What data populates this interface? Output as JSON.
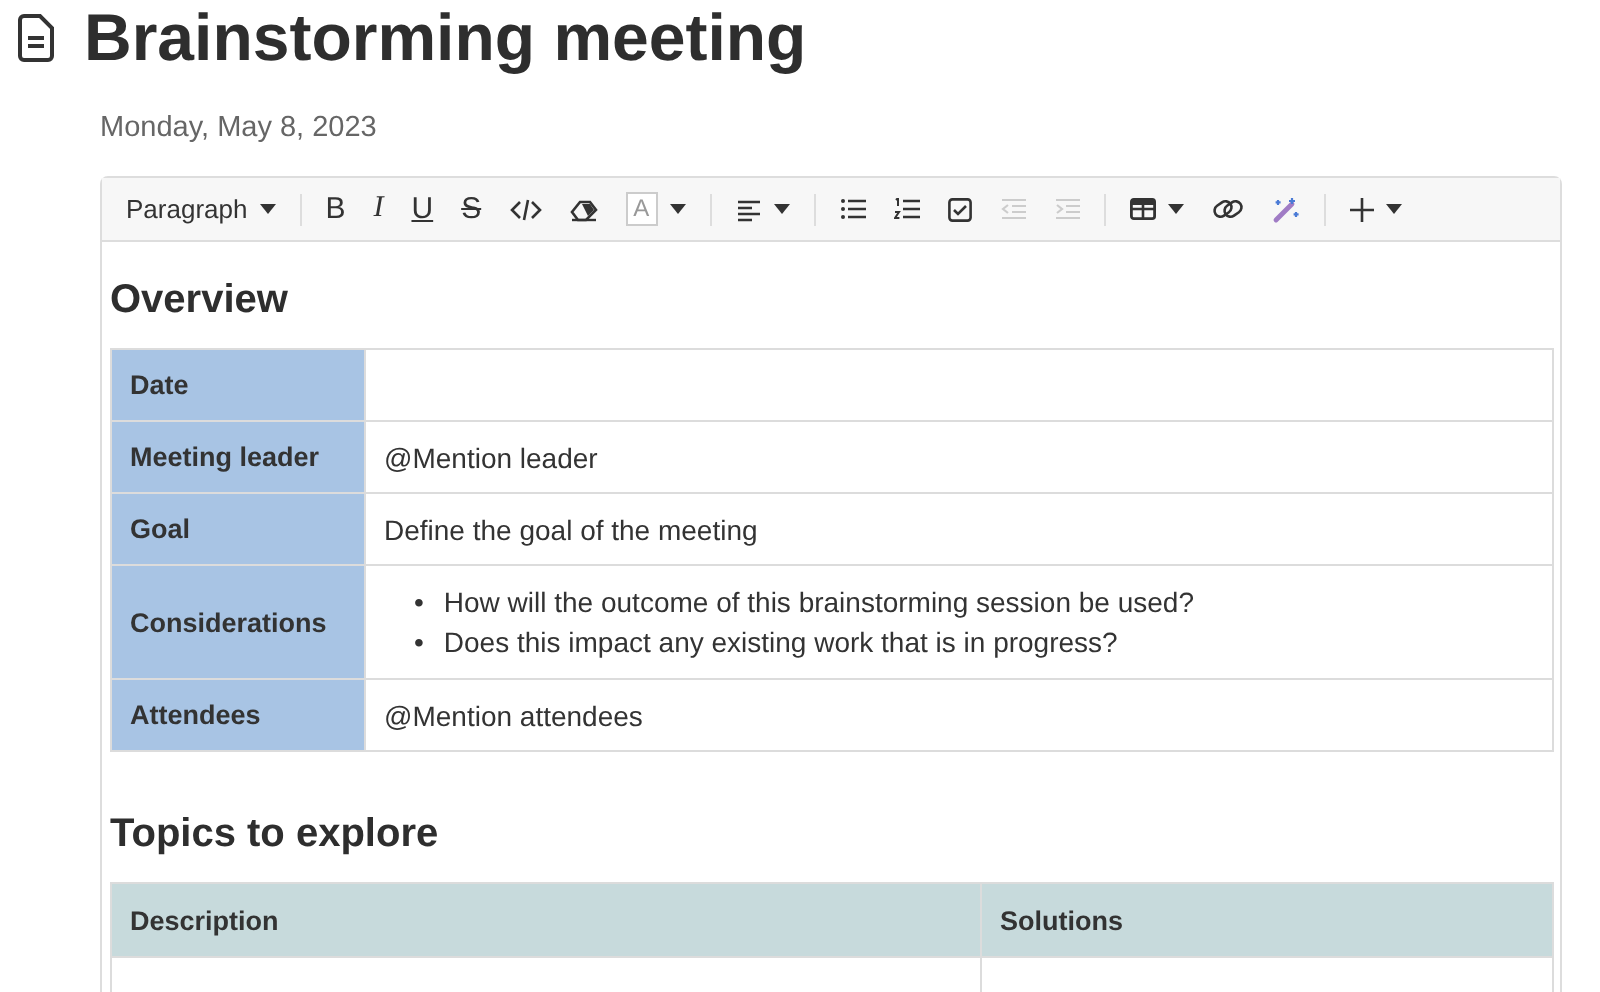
{
  "page": {
    "title": "Brainstorming meeting",
    "date": "Monday, May 8, 2023"
  },
  "toolbar": [
    {
      "kind": "style",
      "label": "Paragraph",
      "has_menu": true,
      "disabled": false
    },
    {
      "kind": "separator"
    },
    {
      "kind": "bold",
      "label": "B",
      "has_menu": false,
      "disabled": false
    },
    {
      "kind": "italic",
      "label": "I",
      "has_menu": false,
      "disabled": false
    },
    {
      "kind": "underline",
      "label": "U",
      "has_menu": false,
      "disabled": false
    },
    {
      "kind": "strike",
      "label": "S",
      "has_menu": false,
      "disabled": false
    },
    {
      "kind": "code",
      "has_menu": false,
      "disabled": false
    },
    {
      "kind": "eraser",
      "has_menu": false,
      "disabled": false
    },
    {
      "kind": "color",
      "label": "A",
      "has_menu": true,
      "disabled": false
    },
    {
      "kind": "separator"
    },
    {
      "kind": "align",
      "has_menu": true,
      "disabled": false
    },
    {
      "kind": "separator"
    },
    {
      "kind": "bullets",
      "has_menu": false,
      "disabled": false
    },
    {
      "kind": "numbers",
      "has_menu": false,
      "disabled": false
    },
    {
      "kind": "checklist",
      "has_menu": false,
      "disabled": false
    },
    {
      "kind": "outdent",
      "has_menu": false,
      "disabled": true
    },
    {
      "kind": "indent",
      "has_menu": false,
      "disabled": true
    },
    {
      "kind": "separator"
    },
    {
      "kind": "table",
      "has_menu": true,
      "disabled": false
    },
    {
      "kind": "link",
      "has_menu": false,
      "disabled": false
    },
    {
      "kind": "magic",
      "has_menu": false,
      "disabled": false
    },
    {
      "kind": "separator"
    },
    {
      "kind": "plus",
      "has_menu": true,
      "disabled": false
    }
  ],
  "sections": [
    {
      "heading": "Overview",
      "table": {
        "kind": "key_value",
        "rows": [
          {
            "label": "Date"
          },
          {
            "label": "Meeting leader",
            "value": "@Mention leader"
          },
          {
            "label": "Goal",
            "value": "Define the goal of the meeting"
          },
          {
            "label": "Considerations",
            "marker": "•",
            "bullets": [
              "How will the outcome of this brainstorming session be used?",
              "Does this impact any existing work that is in progress?"
            ]
          },
          {
            "label": "Attendees",
            "value": "@Mention attendees"
          }
        ]
      }
    },
    {
      "heading": "Topics to explore",
      "table": {
        "kind": "columns",
        "columns": [
          "Description",
          "Solutions"
        ]
      }
    }
  ]
}
